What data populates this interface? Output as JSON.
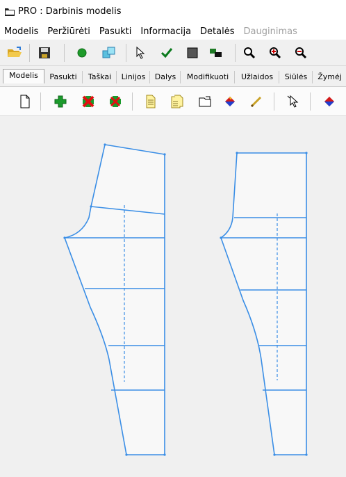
{
  "window": {
    "title": "PRO : Darbinis modelis"
  },
  "menu": {
    "items": [
      "Modelis",
      "Peržiūrėti",
      "Pasukti",
      "Informacija",
      "Detalės"
    ],
    "disabled_item": "Dauginimas"
  },
  "toolbar_main": {
    "icons": [
      "open-folder-icon",
      "save-disk-icon",
      "green-circle-icon",
      "copy-windows-icon",
      "pointer-arrow-icon",
      "checkmark-icon",
      "square-icon",
      "layers-icon",
      "zoom-icon",
      "zoom-in-icon",
      "zoom-out-icon"
    ]
  },
  "tabs": [
    "Modelis",
    "Pasukti",
    "Taškai",
    "Linijos",
    "Dalys",
    "Modifikuoti",
    "Užlaidos",
    "Siūlės",
    "Žymėj"
  ],
  "active_tab": "Modelis",
  "toolbar_model": {
    "icons": [
      "new-document-icon",
      "add-plus-icon",
      "delete-cross-icon",
      "delete-part-icon",
      "document-icon",
      "documents-icon",
      "part-icon",
      "fill-color-icon",
      "pencil-icon",
      "select-pointer-icon",
      "paint-bucket-icon"
    ]
  },
  "colors": {
    "pattern_line": "#3a8ee6",
    "pattern_fill": "#f8f8f8",
    "canvas_bg": "#f0f0f0"
  }
}
